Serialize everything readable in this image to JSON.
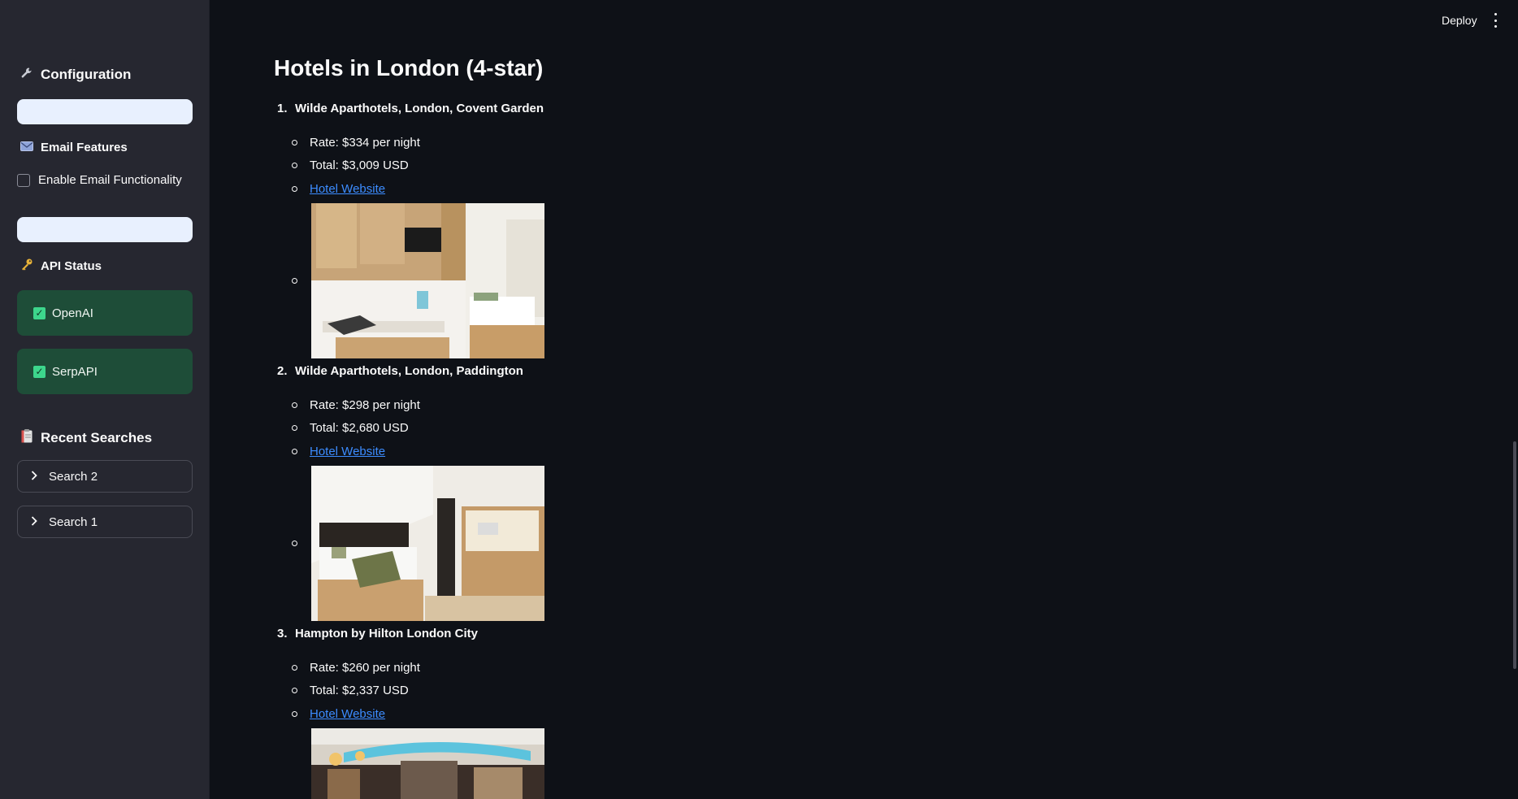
{
  "sidebar": {
    "config_title": "Configuration",
    "email_title": "Email Features",
    "email_checkbox_label": "Enable Email Functionality",
    "api_title": "API Status",
    "api_status": [
      {
        "label": "OpenAI"
      },
      {
        "label": "SerpAPI"
      }
    ],
    "recent_title": "Recent Searches",
    "recent_searches": [
      {
        "label": "Search 2"
      },
      {
        "label": "Search 1"
      }
    ],
    "icons": {
      "config": "wrench-icon",
      "email": "envelope-icon",
      "api": "key-icon",
      "recent": "clipboard-icon",
      "check": "check-box-icon",
      "chevron": "chevron-right-icon"
    }
  },
  "header": {
    "deploy_label": "Deploy",
    "menu_icon": "kebab-menu-icon"
  },
  "main": {
    "title": "Hotels in London (4-star)",
    "hotels": [
      {
        "number": "1.",
        "name": "Wilde Aparthotels, London, Covent Garden",
        "rate": "Rate: $334 per night",
        "total": "Total: $3,009 USD",
        "link": "Hotel Website"
      },
      {
        "number": "2.",
        "name": "Wilde Aparthotels, London, Paddington",
        "rate": "Rate: $298 per night",
        "total": "Total: $2,680 USD",
        "link": "Hotel Website"
      },
      {
        "number": "3.",
        "name": "Hampton by Hilton London City",
        "rate": "Rate: $260 per night",
        "total": "Total: $2,337 USD",
        "link": "Hotel Website"
      }
    ]
  },
  "colors": {
    "background": "#0e1117",
    "sidebar": "#262730",
    "status_green": "#1e4d38",
    "link": "#3c8cff",
    "input": "#e8f0fe"
  }
}
